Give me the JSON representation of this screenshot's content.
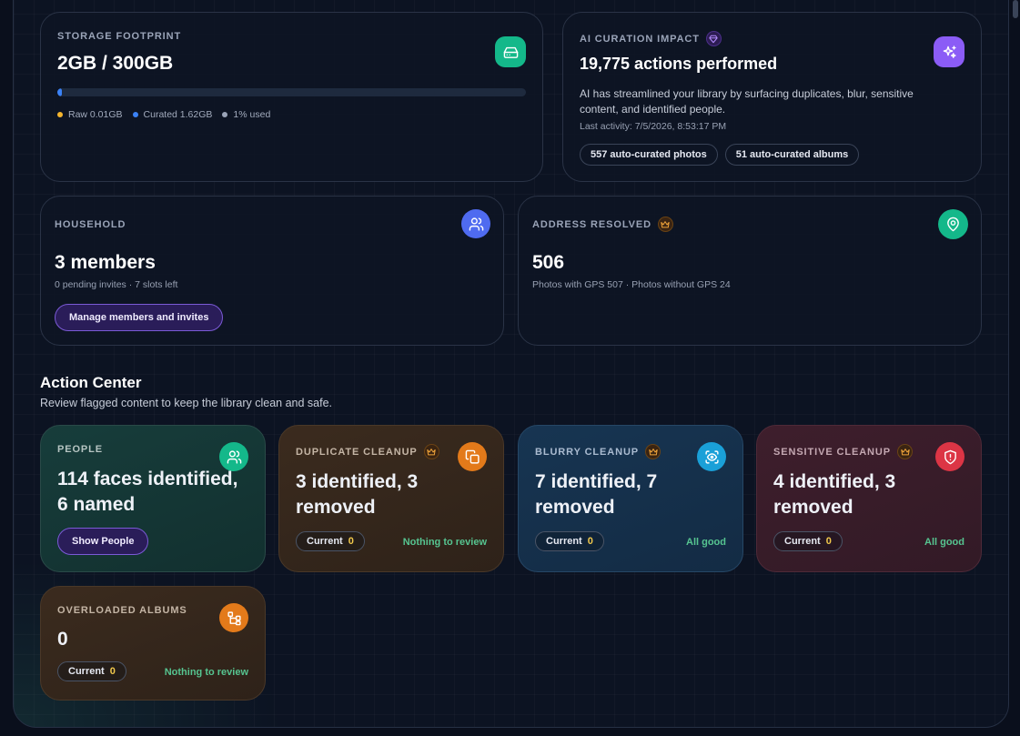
{
  "storage": {
    "label": "STORAGE FOOTPRINT",
    "value": "2GB / 300GB",
    "used_fraction": 0.01,
    "legend": [
      {
        "color": "#f5b52e",
        "text": "Raw 0.01GB"
      },
      {
        "color": "#3b82f6",
        "text": "Curated 1.62GB"
      },
      {
        "color": "#9aa4b8",
        "text": "1% used"
      }
    ],
    "icon": "hard-drive-icon",
    "accent": "#14b88a"
  },
  "ai": {
    "label": "AI CURATION IMPACT",
    "value": "19,775 actions performed",
    "description": "AI has streamlined your library by surfacing duplicates, blur, sensitive content, and identified people.",
    "last_activity": "Last activity: 7/5/2026, 8:53:17 PM",
    "pills": [
      "557 auto-curated photos",
      "51 auto-curated albums"
    ],
    "icon": "sparkles-icon",
    "accent": "#8b5cf6"
  },
  "household": {
    "label": "HOUSEHOLD",
    "value": "3 members",
    "sub": "0 pending invites · 7 slots left",
    "button": "Manage members and invites",
    "icon": "users-icon",
    "accent": "#4f6bf0"
  },
  "address": {
    "label": "ADDRESS RESOLVED",
    "value": "506",
    "sub": "Photos with GPS 507 · Photos without GPS 24",
    "icon": "map-pin-icon",
    "accent": "#14b88a"
  },
  "action_center": {
    "title": "Action Center",
    "subtitle": "Review flagged content to keep the library clean and safe."
  },
  "people": {
    "label": "PEOPLE",
    "line1": "114 faces identified,",
    "line2": "6 named",
    "button": "Show People",
    "icon": "users-icon",
    "accent": "#14b88a"
  },
  "duplicate": {
    "label": "DUPLICATE CLEANUP",
    "line1": "3 identified, 3",
    "line2": "removed",
    "current_label": "Current",
    "current_value": "0",
    "status": "Nothing to review",
    "icon": "copy-icon",
    "accent": "#e37a1a"
  },
  "blurry": {
    "label": "BLURRY CLEANUP",
    "line1": "7 identified, 7",
    "line2": "removed",
    "current_label": "Current",
    "current_value": "0",
    "status": "All good",
    "icon": "scan-eye-icon",
    "accent": "#1aa0d8"
  },
  "sensitive": {
    "label": "SENSITIVE CLEANUP",
    "line1": "4 identified, 3",
    "line2": "removed",
    "current_label": "Current",
    "current_value": "0",
    "status": "All good",
    "icon": "shield-alert-icon",
    "accent": "#dc3545"
  },
  "overloaded": {
    "label": "OVERLOADED ALBUMS",
    "value": "0",
    "current_label": "Current",
    "current_value": "0",
    "status": "Nothing to review",
    "icon": "git-branch-icon",
    "accent": "#e37a1a"
  }
}
